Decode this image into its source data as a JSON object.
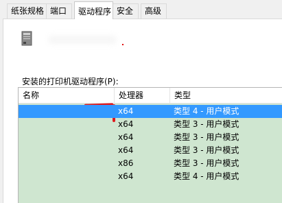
{
  "tabs": [
    {
      "label": "纸张规格"
    },
    {
      "label": "端口"
    },
    {
      "label": "驱动程序",
      "active": true
    },
    {
      "label": "安全"
    },
    {
      "label": "高级"
    }
  ],
  "drivers_label": "安装的打印机驱动程序(P):",
  "columns": {
    "name": "名称",
    "processor": "处理器",
    "type": "类型"
  },
  "rows": [
    {
      "processor": "x64",
      "type": "类型 4 - 用户模式",
      "selected": true
    },
    {
      "processor": "x64",
      "type": "类型 3 - 用户模式"
    },
    {
      "processor": "x64",
      "type": "类型 3 - 用户模式"
    },
    {
      "processor": "x64",
      "type": "类型 3 - 用户模式"
    },
    {
      "processor": "x86",
      "type": "类型 3 - 用户模式"
    },
    {
      "processor": "x64",
      "type": "类型 4 - 用户模式"
    }
  ],
  "colors": {
    "selection": "#3399ff",
    "list_bg": "#cfe6d0",
    "redaction_mark": "#e0191d"
  },
  "icons": {
    "printer": "printer-icon"
  }
}
